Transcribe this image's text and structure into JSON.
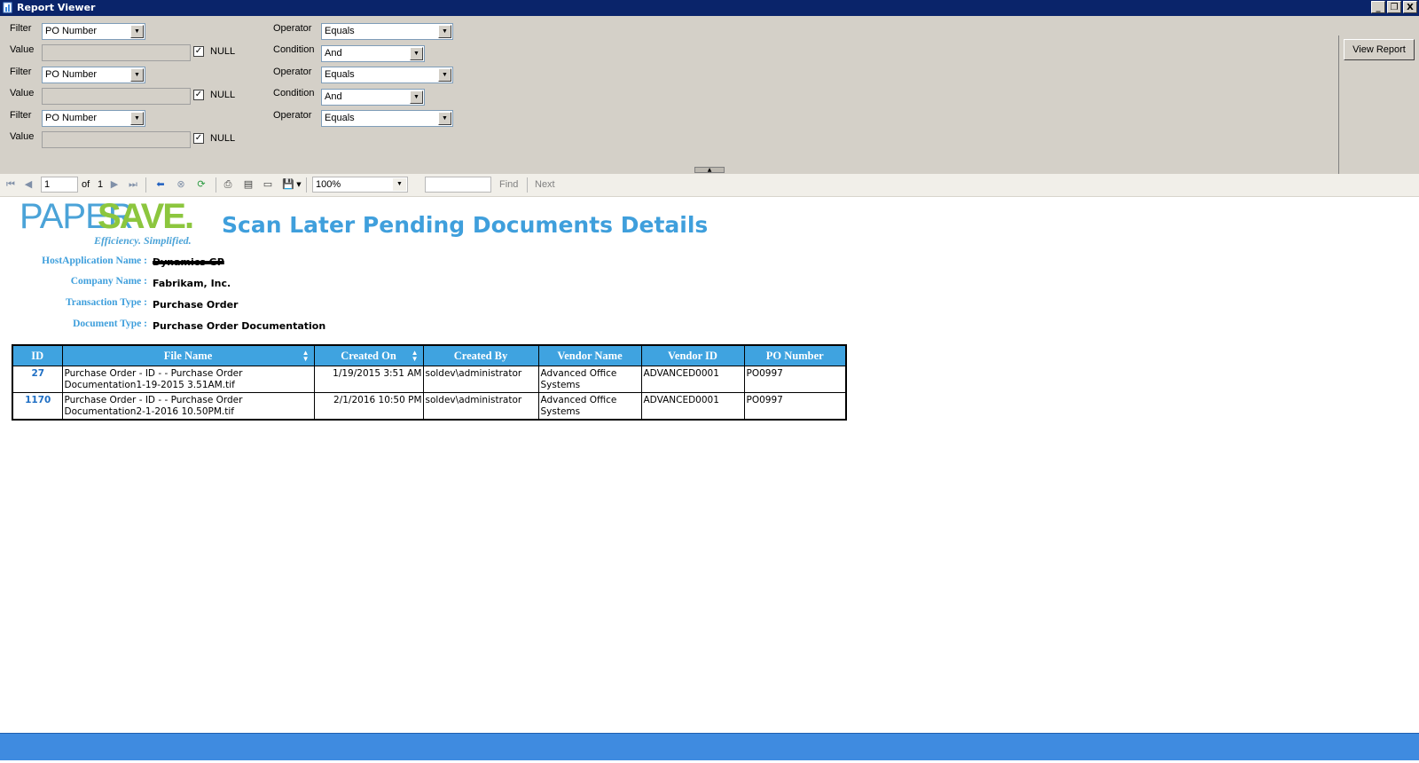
{
  "window": {
    "title": "Report Viewer",
    "controls": [
      "_",
      "❐",
      "X"
    ]
  },
  "params": {
    "labels": {
      "filter": "Filter",
      "value": "Value",
      "operator": "Operator",
      "condition": "Condition",
      "null": "NULL"
    },
    "rows": [
      {
        "filter": "PO Number",
        "operator": "Equals",
        "condition": "And",
        "null_checked": true
      },
      {
        "filter": "PO Number",
        "operator": "Equals",
        "condition": "And",
        "null_checked": true
      },
      {
        "filter": "PO Number",
        "operator": "Equals",
        "null_checked": true
      }
    ],
    "view_report": "View Report"
  },
  "toolbar": {
    "page": "1",
    "of_label": "of",
    "total_pages": "1",
    "zoom": "100%",
    "find_label": "Find",
    "next_label": "Next"
  },
  "report": {
    "logo": {
      "paper": "PAPER",
      "save": "SAVE.",
      "tagline": "Efficiency. Simplified."
    },
    "title": "Scan Later Pending Documents Details",
    "meta": [
      {
        "label": "HostApplication Name :",
        "value": "Dynamics GP"
      },
      {
        "label": "Company Name :",
        "value": "Fabrikam, Inc."
      },
      {
        "label": "Transaction Type :",
        "value": "Purchase Order"
      },
      {
        "label": "Document Type :",
        "value": "Purchase Order Documentation"
      }
    ],
    "columns": [
      "ID",
      "File Name",
      "Created On",
      "Created By",
      "Vendor Name",
      "Vendor ID",
      "PO Number"
    ],
    "rows": [
      {
        "id": "27",
        "file_name": "Purchase Order - ID -  - Purchase Order Documentation1-19-2015 3.51AM.tif",
        "created_on": "1/19/2015 3:51 AM",
        "created_by": "soldev\\administrator",
        "vendor_name": "Advanced Office Systems",
        "vendor_id": "ADVANCED0001",
        "po_number": "PO0997"
      },
      {
        "id": "1170",
        "file_name": "Purchase Order - ID -  - Purchase Order Documentation2-1-2016 10.50PM.tif",
        "created_on": "2/1/2016 10:50 PM",
        "created_by": "soldev\\administrator",
        "vendor_name": "Advanced Office Systems",
        "vendor_id": "ADVANCED0001",
        "po_number": "PO0997"
      }
    ]
  },
  "colors": {
    "titlebar": "#0a246a",
    "accent": "#3f9fdc",
    "logo_green": "#8cc63e",
    "statusbar": "#3f8be0"
  }
}
